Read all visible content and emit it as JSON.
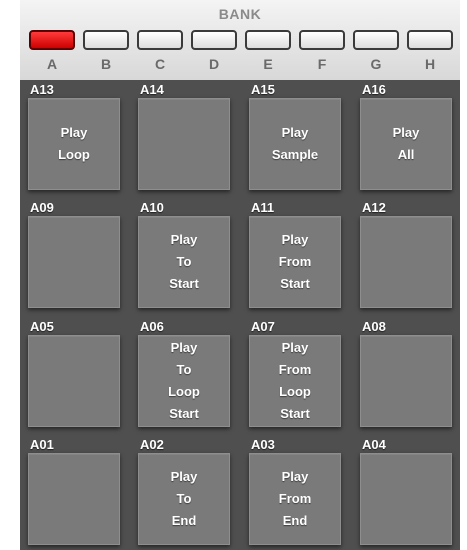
{
  "bank": {
    "title": "BANK",
    "active_index": 0,
    "colors": {
      "active": "#e00000",
      "inactive": "#ffffff"
    },
    "buttons": [
      {
        "label": "A"
      },
      {
        "label": "B"
      },
      {
        "label": "C"
      },
      {
        "label": "D"
      },
      {
        "label": "E"
      },
      {
        "label": "F"
      },
      {
        "label": "G"
      },
      {
        "label": "H"
      }
    ]
  },
  "pads": [
    {
      "id": "A13",
      "label": [
        "Play",
        "Loop"
      ]
    },
    {
      "id": "A14",
      "label": []
    },
    {
      "id": "A15",
      "label": [
        "Play",
        "Sample"
      ]
    },
    {
      "id": "A16",
      "label": [
        "Play",
        "All"
      ]
    },
    {
      "id": "A09",
      "label": []
    },
    {
      "id": "A10",
      "label": [
        "Play",
        "To",
        "Start"
      ]
    },
    {
      "id": "A11",
      "label": [
        "Play",
        "From",
        "Start"
      ]
    },
    {
      "id": "A12",
      "label": []
    },
    {
      "id": "A05",
      "label": []
    },
    {
      "id": "A06",
      "label": [
        "Play",
        "To",
        "Loop",
        "Start"
      ]
    },
    {
      "id": "A07",
      "label": [
        "Play",
        "From",
        "Loop",
        "Start"
      ]
    },
    {
      "id": "A08",
      "label": []
    },
    {
      "id": "A01",
      "label": []
    },
    {
      "id": "A02",
      "label": [
        "Play",
        "To",
        "End"
      ]
    },
    {
      "id": "A03",
      "label": [
        "Play",
        "From",
        "End"
      ]
    },
    {
      "id": "A04",
      "label": []
    }
  ]
}
